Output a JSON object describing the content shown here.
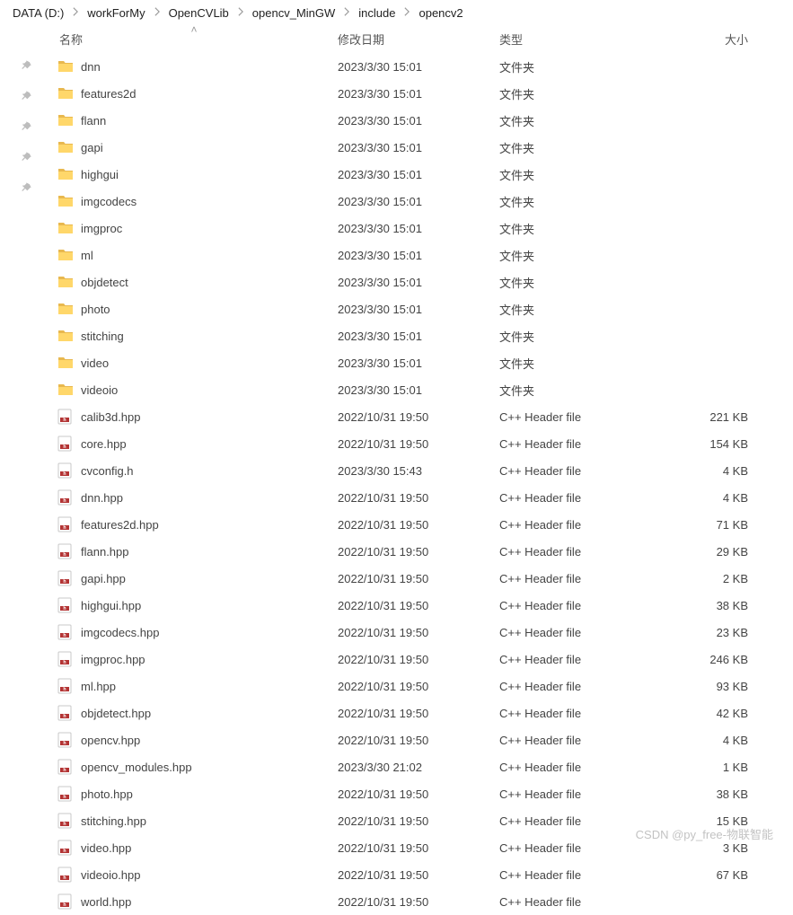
{
  "breadcrumb": [
    {
      "label": "DATA (D:)"
    },
    {
      "label": "workForMy"
    },
    {
      "label": "OpenCVLib"
    },
    {
      "label": "opencv_MinGW"
    },
    {
      "label": "include"
    },
    {
      "label": "opencv2"
    }
  ],
  "columns": {
    "name": "名称",
    "modified": "修改日期",
    "type": "类型",
    "size": "大小"
  },
  "type_labels": {
    "folder": "文件夹",
    "header": "C++ Header file"
  },
  "rows": [
    {
      "icon": "folder",
      "name": "dnn",
      "modified": "2023/3/30 15:01",
      "type": "文件夹",
      "size": ""
    },
    {
      "icon": "folder",
      "name": "features2d",
      "modified": "2023/3/30 15:01",
      "type": "文件夹",
      "size": ""
    },
    {
      "icon": "folder",
      "name": "flann",
      "modified": "2023/3/30 15:01",
      "type": "文件夹",
      "size": ""
    },
    {
      "icon": "folder",
      "name": "gapi",
      "modified": "2023/3/30 15:01",
      "type": "文件夹",
      "size": ""
    },
    {
      "icon": "folder",
      "name": "highgui",
      "modified": "2023/3/30 15:01",
      "type": "文件夹",
      "size": ""
    },
    {
      "icon": "folder",
      "name": "imgcodecs",
      "modified": "2023/3/30 15:01",
      "type": "文件夹",
      "size": ""
    },
    {
      "icon": "folder",
      "name": "imgproc",
      "modified": "2023/3/30 15:01",
      "type": "文件夹",
      "size": ""
    },
    {
      "icon": "folder",
      "name": "ml",
      "modified": "2023/3/30 15:01",
      "type": "文件夹",
      "size": ""
    },
    {
      "icon": "folder",
      "name": "objdetect",
      "modified": "2023/3/30 15:01",
      "type": "文件夹",
      "size": ""
    },
    {
      "icon": "folder",
      "name": "photo",
      "modified": "2023/3/30 15:01",
      "type": "文件夹",
      "size": ""
    },
    {
      "icon": "folder",
      "name": "stitching",
      "modified": "2023/3/30 15:01",
      "type": "文件夹",
      "size": ""
    },
    {
      "icon": "folder",
      "name": "video",
      "modified": "2023/3/30 15:01",
      "type": "文件夹",
      "size": ""
    },
    {
      "icon": "folder",
      "name": "videoio",
      "modified": "2023/3/30 15:01",
      "type": "文件夹",
      "size": ""
    },
    {
      "icon": "h",
      "name": "calib3d.hpp",
      "modified": "2022/10/31 19:50",
      "type": "C++ Header file",
      "size": "221 KB"
    },
    {
      "icon": "h",
      "name": "core.hpp",
      "modified": "2022/10/31 19:50",
      "type": "C++ Header file",
      "size": "154 KB"
    },
    {
      "icon": "h",
      "name": "cvconfig.h",
      "modified": "2023/3/30 15:43",
      "type": "C++ Header file",
      "size": "4 KB"
    },
    {
      "icon": "h",
      "name": "dnn.hpp",
      "modified": "2022/10/31 19:50",
      "type": "C++ Header file",
      "size": "4 KB"
    },
    {
      "icon": "h",
      "name": "features2d.hpp",
      "modified": "2022/10/31 19:50",
      "type": "C++ Header file",
      "size": "71 KB"
    },
    {
      "icon": "h",
      "name": "flann.hpp",
      "modified": "2022/10/31 19:50",
      "type": "C++ Header file",
      "size": "29 KB"
    },
    {
      "icon": "h",
      "name": "gapi.hpp",
      "modified": "2022/10/31 19:50",
      "type": "C++ Header file",
      "size": "2 KB"
    },
    {
      "icon": "h",
      "name": "highgui.hpp",
      "modified": "2022/10/31 19:50",
      "type": "C++ Header file",
      "size": "38 KB"
    },
    {
      "icon": "h",
      "name": "imgcodecs.hpp",
      "modified": "2022/10/31 19:50",
      "type": "C++ Header file",
      "size": "23 KB"
    },
    {
      "icon": "h",
      "name": "imgproc.hpp",
      "modified": "2022/10/31 19:50",
      "type": "C++ Header file",
      "size": "246 KB"
    },
    {
      "icon": "h",
      "name": "ml.hpp",
      "modified": "2022/10/31 19:50",
      "type": "C++ Header file",
      "size": "93 KB"
    },
    {
      "icon": "h",
      "name": "objdetect.hpp",
      "modified": "2022/10/31 19:50",
      "type": "C++ Header file",
      "size": "42 KB"
    },
    {
      "icon": "h",
      "name": "opencv.hpp",
      "modified": "2022/10/31 19:50",
      "type": "C++ Header file",
      "size": "4 KB"
    },
    {
      "icon": "h",
      "name": "opencv_modules.hpp",
      "modified": "2023/3/30 21:02",
      "type": "C++ Header file",
      "size": "1 KB"
    },
    {
      "icon": "h",
      "name": "photo.hpp",
      "modified": "2022/10/31 19:50",
      "type": "C++ Header file",
      "size": "38 KB"
    },
    {
      "icon": "h",
      "name": "stitching.hpp",
      "modified": "2022/10/31 19:50",
      "type": "C++ Header file",
      "size": "15 KB"
    },
    {
      "icon": "h",
      "name": "video.hpp",
      "modified": "2022/10/31 19:50",
      "type": "C++ Header file",
      "size": "3 KB"
    },
    {
      "icon": "h",
      "name": "videoio.hpp",
      "modified": "2022/10/31 19:50",
      "type": "C++ Header file",
      "size": "67 KB"
    },
    {
      "icon": "h",
      "name": "world.hpp",
      "modified": "2022/10/31 19:50",
      "type": "C++ Header file",
      "size": ""
    }
  ],
  "watermark": "CSDN @py_free-物联智能"
}
